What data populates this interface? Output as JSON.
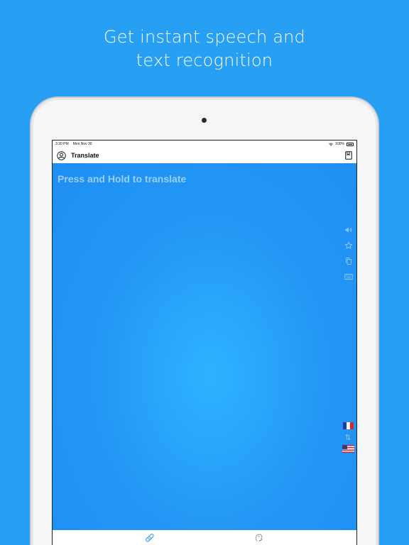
{
  "headline": {
    "line1": "Get instant speech and",
    "line2": "text recognition"
  },
  "status_bar": {
    "time": "3:30 PM",
    "date": "Mon Nov 30",
    "battery": "100%"
  },
  "nav": {
    "title": "Translate",
    "left_icon": "profile-icon",
    "right_icon": "phrasebook-icon"
  },
  "translate_area": {
    "placeholder": "Press and Hold to translate"
  },
  "side_tools": [
    "speaker-icon",
    "star-icon",
    "copy-icon",
    "keyboard-icon"
  ],
  "languages": {
    "source_flag": "flag-france-icon",
    "swap": "swap-arrows-icon",
    "target_flag": "flag-usa-icon"
  },
  "tabs": [
    "translate-tab-icon",
    "conversation-tab-icon"
  ],
  "colors": {
    "background": "#279ff2",
    "translate_area": "#2296f5",
    "icon_tint": "#bfe3ff"
  }
}
